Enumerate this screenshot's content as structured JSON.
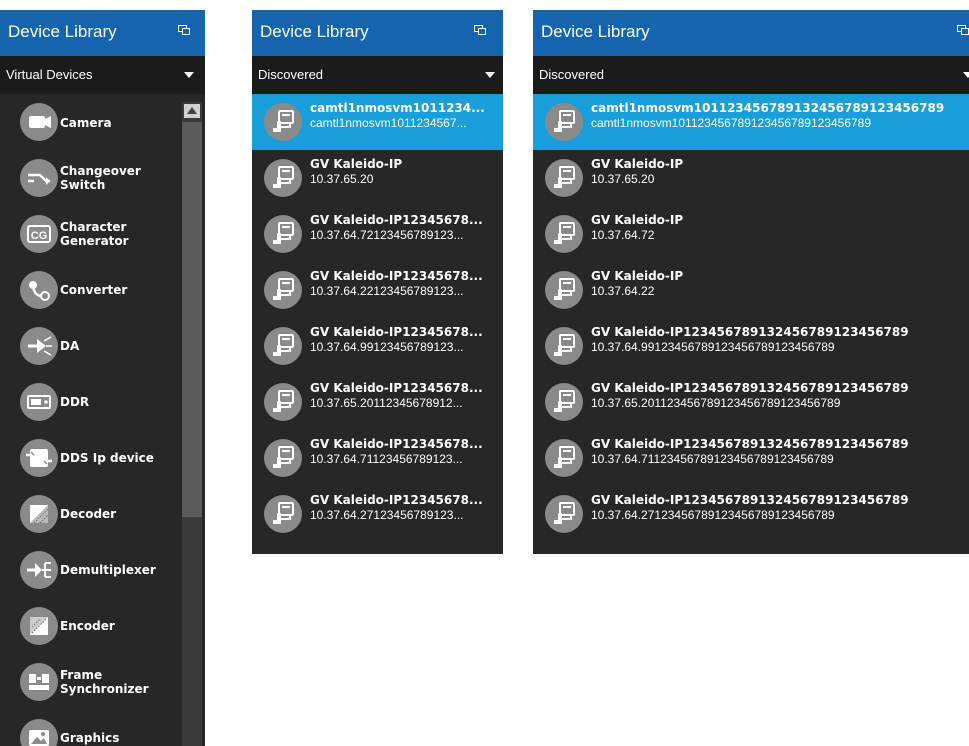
{
  "panel1": {
    "title": "Device Library",
    "filter": "Virtual Devices",
    "items": [
      {
        "label": "Camera",
        "icon": "camera-icon"
      },
      {
        "label": "Changeover Switch",
        "icon": "changeover-switch-icon"
      },
      {
        "label": "Character Generator",
        "icon": "cg-icon",
        "icon_text": "CG"
      },
      {
        "label": "Converter",
        "icon": "converter-icon"
      },
      {
        "label": "DA",
        "icon": "da-icon"
      },
      {
        "label": "DDR",
        "icon": "ddr-icon"
      },
      {
        "label": "DDS Ip device",
        "icon": "dds-ip-device-icon"
      },
      {
        "label": "Decoder",
        "icon": "decoder-icon"
      },
      {
        "label": "Demultiplexer",
        "icon": "demultiplexer-icon"
      },
      {
        "label": "Encoder",
        "icon": "encoder-icon"
      },
      {
        "label": "Frame Synchronizer",
        "icon": "frame-synchronizer-icon"
      },
      {
        "label": "Graphics",
        "icon": "graphics-icon"
      }
    ]
  },
  "panel2": {
    "title": "Device Library",
    "filter": "Discovered",
    "items": [
      {
        "title": "camtl1nmosvm1011234...",
        "sub": "camtl1nmosvm1011234567...",
        "selected": true
      },
      {
        "title": "GV Kaleido-IP",
        "sub": "10.37.65.20"
      },
      {
        "title": "GV Kaleido-IP12345678...",
        "sub": "10.37.64.72123456789123..."
      },
      {
        "title": "GV Kaleido-IP12345678...",
        "sub": "10.37.64.22123456789123..."
      },
      {
        "title": "GV Kaleido-IP12345678...",
        "sub": "10.37.64.99123456789123..."
      },
      {
        "title": "GV Kaleido-IP12345678...",
        "sub": "10.37.65.20112345678912..."
      },
      {
        "title": "GV Kaleido-IP12345678...",
        "sub": "10.37.64.71123456789123..."
      },
      {
        "title": "GV Kaleido-IP12345678...",
        "sub": "10.37.64.27123456789123..."
      }
    ]
  },
  "panel3": {
    "title": "Device Library",
    "filter": "Discovered",
    "items": [
      {
        "title": "camtl1nmosvm1011234567891324567891234567​89",
        "sub": "camtl1nmosvm101123456789123456789123456789",
        "selected": true
      },
      {
        "title": "GV Kaleido-IP",
        "sub": "10.37.65.20"
      },
      {
        "title": "GV Kaleido-IP",
        "sub": "10.37.64.72"
      },
      {
        "title": "GV Kaleido-IP",
        "sub": "10.37.64.22"
      },
      {
        "title": "GV Kaleido-IP1234567891324567891234567​89",
        "sub": "10.37.64.991234567891234567891234567​89"
      },
      {
        "title": "GV Kaleido-IP1234567891324567891234567​89",
        "sub": "10.37.65.201123456789123456789123456789"
      },
      {
        "title": "GV Kaleido-IP1234567891324567891234567​89",
        "sub": "10.37.64.711234567891234567891234567​89"
      },
      {
        "title": "GV Kaleido-IP1234567891324567891234567​89",
        "sub": "10.37.64.271234567891234567891234567​89"
      }
    ]
  },
  "colors": {
    "header": "#1564ae",
    "panel_bg": "#272727",
    "filter_bg": "#1b1b1b",
    "selected": "#1a9ed9",
    "icon_circle": "#8a8a8a"
  }
}
